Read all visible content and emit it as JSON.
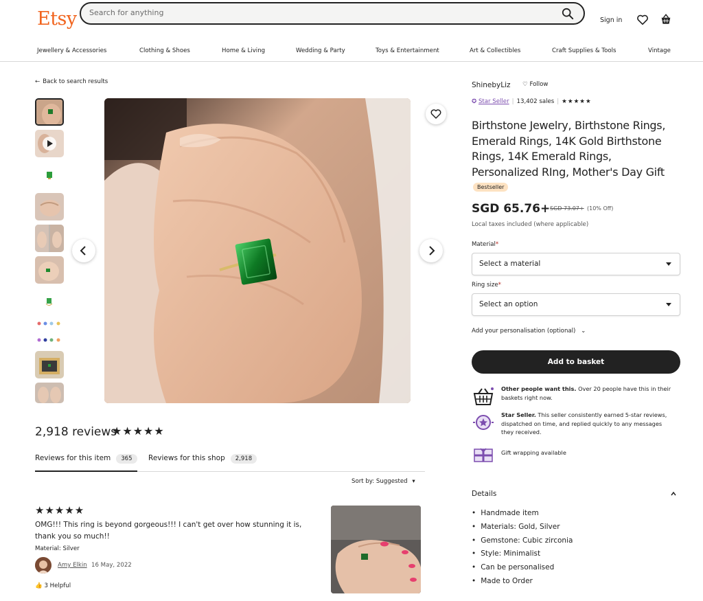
{
  "header": {
    "logo": "Etsy",
    "search_placeholder": "Search for anything",
    "sign_in": "Sign in"
  },
  "categories": [
    "Jewellery & Accessories",
    "Clothing & Shoes",
    "Home & Living",
    "Wedding & Party",
    "Toys & Entertainment",
    "Art & Collectibles",
    "Craft Supplies & Tools",
    "Vintage"
  ],
  "back_link": "Back to search results",
  "reviews": {
    "heading": "2,918 reviews",
    "stars": "★★★★★",
    "tabs": [
      {
        "label": "Reviews for this item",
        "count": "365"
      },
      {
        "label": "Reviews for this shop",
        "count": "2,918"
      }
    ],
    "sort": "Sort by: Suggested",
    "items": [
      {
        "stars": "★★★★★",
        "text": "OMG!!! This ring is beyond gorgeous!!! I can't get over how stunning it is, thank you so much!!",
        "material": "Material: Silver",
        "reviewer": "Amy Elkin",
        "date": "16 May, 2022",
        "helpful": "3 Helpful"
      }
    ]
  },
  "shop": {
    "name": "ShinebyLiz",
    "follow": "Follow",
    "star_seller": "Star Seller",
    "sales": "13,402 sales",
    "stars": "★★★★★"
  },
  "product": {
    "title": "Birthstone Jewelry, Birthstone Rings, Emerald Rings, 14K Gold Birthstone Rings, 14K Emerald Rings, Personalized RIng, Mother's Day Gift",
    "badge": "Bestseller",
    "price": "SGD 65.76+",
    "old_price": "SGD 73.07+",
    "discount": "(10% Off)",
    "taxes": "Local taxes included (where applicable)",
    "material_label": "Material",
    "material_value": "Select a material",
    "ring_size_label": "Ring size",
    "ring_size_value": "Select an option",
    "personalisation": "Add your personalisation (optional)",
    "add_to_basket": "Add to basket"
  },
  "perks": [
    {
      "bold": "Other people want this.",
      "text": " Over 20 people have this in their baskets right now."
    },
    {
      "bold": "Star Seller.",
      "text": " This seller consistently earned 5-star reviews, dispatched on time, and replied quickly to any messages they received."
    },
    {
      "bold": "",
      "text": "Gift wrapping available"
    }
  ],
  "details": {
    "heading": "Details",
    "items": [
      "Handmade item",
      "Materials: Gold, Silver",
      "Gemstone: Cubic zirconia",
      "Style: Minimalist",
      "Can be personalised",
      "Made to Order"
    ]
  },
  "colors": {
    "brand": "#f1641e",
    "star_seller": "#7c4daf",
    "bestseller_bg": "#fde2c2",
    "button": "#222222"
  }
}
